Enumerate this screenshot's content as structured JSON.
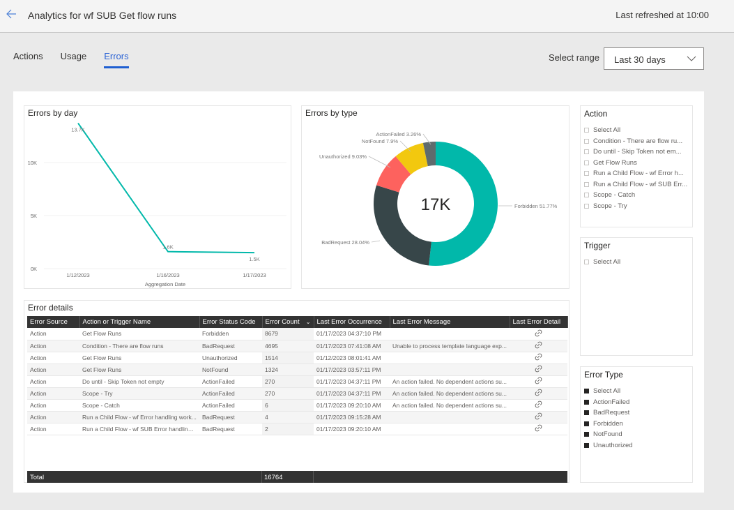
{
  "header": {
    "title": "Analytics for wf SUB Get flow runs",
    "last_refreshed": "Last refreshed at 10:00",
    "back_icon": "arrow-left-icon"
  },
  "tabs": [
    {
      "label": "Actions",
      "active": false
    },
    {
      "label": "Usage",
      "active": false
    },
    {
      "label": "Errors",
      "active": true
    }
  ],
  "range": {
    "label": "Select range",
    "selected": "Last 30 days"
  },
  "colors": {
    "accent": "#1f5fd1",
    "teal": "#01b8aa",
    "dark": "#374649",
    "red": "#fd625e",
    "yellow": "#f2c80f",
    "gray": "#5f6b6d"
  },
  "chart_data": [
    {
      "type": "line",
      "title": "Errors by day",
      "xlabel": "Aggregation Date",
      "ylabel": "",
      "categories": [
        "1/12/2023",
        "1/16/2023",
        "1/17/2023"
      ],
      "values": [
        13700,
        1600,
        1500
      ],
      "data_labels": [
        "13.7K",
        "1.6K",
        "1.5K"
      ],
      "yticks": [
        "0K",
        "5K",
        "10K"
      ],
      "ytick_values": [
        0,
        5000,
        10000
      ],
      "ylim": [
        0,
        14000
      ],
      "grid": true,
      "color": "#01b8aa"
    },
    {
      "type": "pie",
      "title": "Errors by type",
      "center_label": "17K",
      "slices": [
        {
          "name": "Forbidden",
          "percent": 51.77,
          "label": "Forbidden 51.77%",
          "color": "#01b8aa"
        },
        {
          "name": "BadRequest",
          "percent": 28.04,
          "label": "BadRequest 28.04%",
          "color": "#374649"
        },
        {
          "name": "Unauthorized",
          "percent": 9.03,
          "label": "Unauthorized 9.03%",
          "color": "#fd625e"
        },
        {
          "name": "NotFound",
          "percent": 7.9,
          "label": "NotFound 7.9%",
          "color": "#f2c80f"
        },
        {
          "name": "ActionFailed",
          "percent": 3.26,
          "label": "ActionFailed 3.26%",
          "color": "#5f6b6d"
        }
      ]
    }
  ],
  "table": {
    "title": "Error details",
    "columns": [
      "Error Source",
      "Action or Trigger Name",
      "Error Status Code",
      "Error Count",
      "Last Error Occurrence",
      "Last Error Message",
      "Last Error Detail"
    ],
    "sorted_column": "Error Count",
    "rows": [
      [
        "Action",
        "Get Flow Runs",
        "Forbidden",
        "8679",
        "01/17/2023 04:37:10 PM",
        "",
        "link-icon"
      ],
      [
        "Action",
        "Condition - There are flow runs",
        "BadRequest",
        "4695",
        "01/17/2023 07:41:08 AM",
        "Unable to process template language exp...",
        "link-icon"
      ],
      [
        "Action",
        "Get Flow Runs",
        "Unauthorized",
        "1514",
        "01/12/2023 08:01:41 AM",
        "",
        "link-icon"
      ],
      [
        "Action",
        "Get Flow Runs",
        "NotFound",
        "1324",
        "01/17/2023 03:57:11 PM",
        "",
        "link-icon"
      ],
      [
        "Action",
        "Do until - Skip Token not empty",
        "ActionFailed",
        "270",
        "01/17/2023 04:37:11 PM",
        "An action failed. No dependent actions su...",
        "link-icon"
      ],
      [
        "Action",
        "Scope - Try",
        "ActionFailed",
        "270",
        "01/17/2023 04:37:11 PM",
        "An action failed. No dependent actions su...",
        "link-icon"
      ],
      [
        "Action",
        "Scope - Catch",
        "ActionFailed",
        "6",
        "01/17/2023 09:20:10 AM",
        "An action failed. No dependent actions su...",
        "link-icon"
      ],
      [
        "Action",
        "Run a Child Flow - wf Error handling work...",
        "BadRequest",
        "4",
        "01/17/2023 09:15:28 AM",
        "",
        "link-icon"
      ],
      [
        "Action",
        "Run a Child Flow - wf SUB Error handling ...",
        "BadRequest",
        "2",
        "01/17/2023 09:20:10 AM",
        "",
        "link-icon"
      ]
    ],
    "total_label": "Total",
    "total_value": "16764"
  },
  "slicers": {
    "action": {
      "title": "Action",
      "items": [
        {
          "label": "Select All",
          "checked": false
        },
        {
          "label": "Condition - There are flow ru...",
          "checked": false
        },
        {
          "label": "Do until - Skip Token not em...",
          "checked": false
        },
        {
          "label": "Get Flow Runs",
          "checked": false
        },
        {
          "label": "Run a Child Flow - wf Error h...",
          "checked": false
        },
        {
          "label": "Run a Child Flow - wf SUB Err...",
          "checked": false
        },
        {
          "label": "Scope - Catch",
          "checked": false
        },
        {
          "label": "Scope - Try",
          "checked": false
        }
      ]
    },
    "trigger": {
      "title": "Trigger",
      "items": [
        {
          "label": "Select All",
          "checked": false
        }
      ]
    },
    "error_type": {
      "title": "Error Type",
      "items": [
        {
          "label": "Select All",
          "checked": true
        },
        {
          "label": "ActionFailed",
          "checked": true
        },
        {
          "label": "BadRequest",
          "checked": true
        },
        {
          "label": "Forbidden",
          "checked": true
        },
        {
          "label": "NotFound",
          "checked": true
        },
        {
          "label": "Unauthorized",
          "checked": true
        }
      ]
    }
  }
}
